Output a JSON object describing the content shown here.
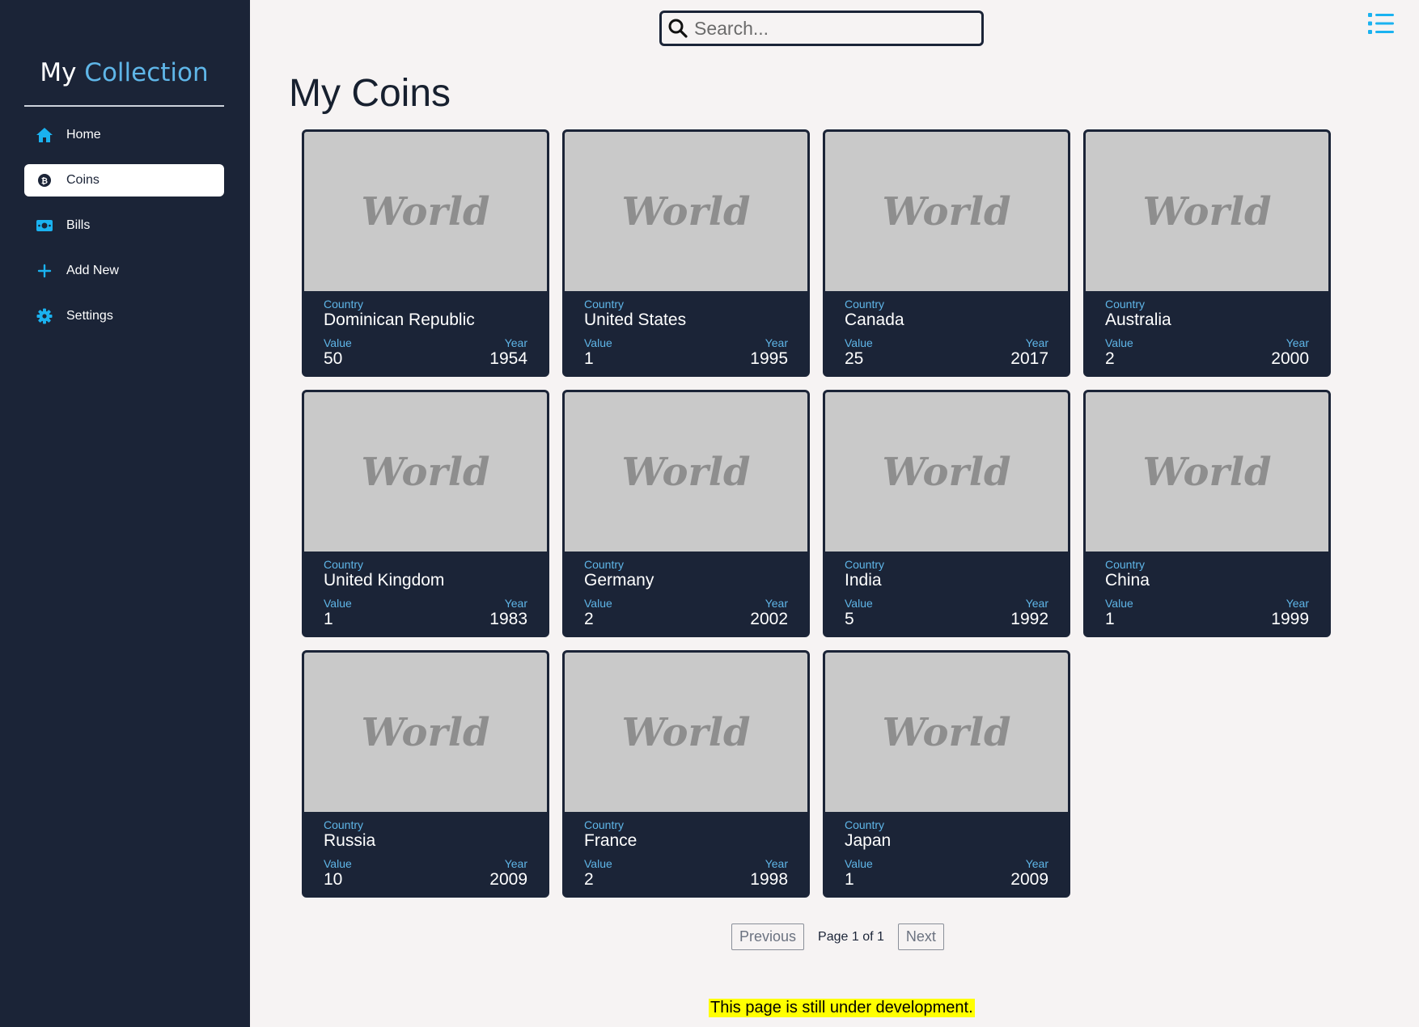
{
  "sidebar": {
    "brand_part1": "My",
    "brand_part2": "Collection",
    "items": [
      {
        "label": "Home",
        "icon": "home-icon"
      },
      {
        "label": "Coins",
        "icon": "coin-icon",
        "active": true
      },
      {
        "label": "Bills",
        "icon": "bill-icon"
      },
      {
        "label": "Add New",
        "icon": "plus-icon"
      },
      {
        "label": "Settings",
        "icon": "gear-icon"
      }
    ]
  },
  "search": {
    "placeholder": "Search..."
  },
  "main": {
    "title": "My Coins"
  },
  "card_labels": {
    "country": "Country",
    "value": "Value",
    "year": "Year"
  },
  "coins": [
    {
      "image_text": "World",
      "country": "Dominican Republic",
      "value": "50",
      "year": "1954"
    },
    {
      "image_text": "World",
      "country": "United States",
      "value": "1",
      "year": "1995"
    },
    {
      "image_text": "World",
      "country": "Canada",
      "value": "25",
      "year": "2017"
    },
    {
      "image_text": "World",
      "country": "Australia",
      "value": "2",
      "year": "2000"
    },
    {
      "image_text": "World",
      "country": "United Kingdom",
      "value": "1",
      "year": "1983"
    },
    {
      "image_text": "World",
      "country": "Germany",
      "value": "2",
      "year": "2002"
    },
    {
      "image_text": "World",
      "country": "India",
      "value": "5",
      "year": "1992"
    },
    {
      "image_text": "World",
      "country": "China",
      "value": "1",
      "year": "1999"
    },
    {
      "image_text": "World",
      "country": "Russia",
      "value": "10",
      "year": "2009"
    },
    {
      "image_text": "World",
      "country": "France",
      "value": "2",
      "year": "1998"
    },
    {
      "image_text": "World",
      "country": "Japan",
      "value": "1",
      "year": "2009"
    }
  ],
  "pagination": {
    "previous": "Previous",
    "info": "Page 1 of 1",
    "next": "Next"
  },
  "dev_note": "This page is still under development.",
  "colors": {
    "sidebar": "#1b2437",
    "accent": "#5fb6e8",
    "icon": "#1ab2f0",
    "highlight": "#ffff00"
  }
}
